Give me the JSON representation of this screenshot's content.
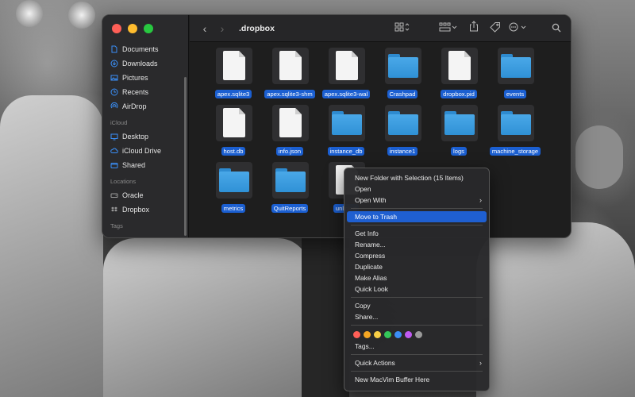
{
  "window": {
    "title": ".dropbox",
    "nav_back": "‹",
    "nav_forward": "›"
  },
  "toolbar_icons": [
    "view-grid-icon",
    "group-icon",
    "share-icon",
    "tag-icon",
    "more-icon",
    "search-icon"
  ],
  "sidebar": {
    "favorites": [
      {
        "label": "Documents",
        "icon": "document-icon"
      },
      {
        "label": "Downloads",
        "icon": "download-icon"
      },
      {
        "label": "Pictures",
        "icon": "pictures-icon"
      },
      {
        "label": "Recents",
        "icon": "clock-icon"
      },
      {
        "label": "AirDrop",
        "icon": "airdrop-icon"
      }
    ],
    "icloud_header": "iCloud",
    "icloud": [
      {
        "label": "Desktop",
        "icon": "desktop-icon"
      },
      {
        "label": "iCloud Drive",
        "icon": "cloud-icon"
      },
      {
        "label": "Shared",
        "icon": "shared-icon"
      }
    ],
    "locations_header": "Locations",
    "locations": [
      {
        "label": "Oracle",
        "icon": "disk-icon"
      },
      {
        "label": "Dropbox",
        "icon": "dropbox-icon"
      }
    ],
    "tags_header": "Tags"
  },
  "files": [
    {
      "name": "apex.sqlite3",
      "kind": "doc"
    },
    {
      "name": "apex.sqlite3-shm",
      "kind": "doc"
    },
    {
      "name": "apex.sqlite3-wal",
      "kind": "doc"
    },
    {
      "name": "Crashpad",
      "kind": "folder"
    },
    {
      "name": "dropbox.pid",
      "kind": "doc"
    },
    {
      "name": "events",
      "kind": "folder"
    },
    {
      "name": "host.db",
      "kind": "doc"
    },
    {
      "name": "info.json",
      "kind": "doc"
    },
    {
      "name": "instance_db",
      "kind": "folder"
    },
    {
      "name": "instance1",
      "kind": "folder"
    },
    {
      "name": "logs",
      "kind": "folder"
    },
    {
      "name": "machine_storage",
      "kind": "folder"
    },
    {
      "name": "metrics",
      "kind": "folder"
    },
    {
      "name": "QuitReports",
      "kind": "folder"
    },
    {
      "name": "unlink.d",
      "kind": "doc"
    }
  ],
  "context_menu": {
    "new_folder": "New Folder with Selection (15 Items)",
    "open": "Open",
    "open_with": "Open With",
    "move_to_trash": "Move to Trash",
    "get_info": "Get Info",
    "rename": "Rename...",
    "compress": "Compress",
    "duplicate": "Duplicate",
    "make_alias": "Make Alias",
    "quick_look": "Quick Look",
    "copy": "Copy",
    "share": "Share...",
    "tag_colors": [
      "#ff5f57",
      "#f5a623",
      "#f7ce46",
      "#34c759",
      "#3b8ef7",
      "#bf5af2",
      "#9a9a9a"
    ],
    "tags": "Tags...",
    "quick_actions": "Quick Actions",
    "new_macvim": "New MacVim Buffer Here"
  }
}
